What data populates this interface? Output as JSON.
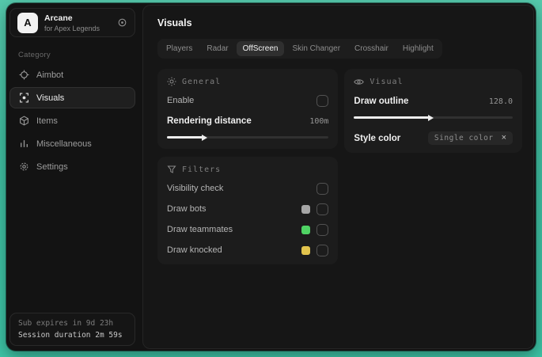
{
  "sidebar": {
    "logo": {
      "letter": "A",
      "title": "Arcane",
      "subtitle": "for Apex Legends"
    },
    "category_label": "Category",
    "items": [
      {
        "label": "Aimbot",
        "icon": "crosshair-icon",
        "active": false
      },
      {
        "label": "Visuals",
        "icon": "eye-scan-icon",
        "active": true
      },
      {
        "label": "Items",
        "icon": "cube-icon",
        "active": false
      },
      {
        "label": "Miscellaneous",
        "icon": "bars-icon",
        "active": false
      },
      {
        "label": "Settings",
        "icon": "gear-icon",
        "active": false
      }
    ],
    "footer": {
      "line1": "Sub expires in 9d 23h",
      "line2": "Session duration 2m 59s"
    }
  },
  "main": {
    "title": "Visuals",
    "tabs": [
      {
        "label": "Players",
        "active": false
      },
      {
        "label": "Radar",
        "active": false
      },
      {
        "label": "OffScreen",
        "active": true
      },
      {
        "label": "Skin Changer",
        "active": false
      },
      {
        "label": "Crosshair",
        "active": false
      },
      {
        "label": "Highlight",
        "active": false
      }
    ],
    "general": {
      "title": "General",
      "enable_label": "Enable",
      "enable_checked": false,
      "rendering_label": "Rendering distance",
      "rendering_value": "100m",
      "slider_percent": 22
    },
    "visual": {
      "title": "Visual",
      "outline_label": "Draw outline",
      "outline_value": "128.0",
      "slider_percent": 47,
      "style_label": "Style color",
      "style_value": "Single color",
      "style_remove_glyph": "×"
    },
    "filters": {
      "title": "Filters",
      "rows": [
        {
          "label": "Visibility check",
          "swatch": null,
          "checked": false
        },
        {
          "label": "Draw bots",
          "swatch": "#a6a6a6",
          "checked": false
        },
        {
          "label": "Draw teammates",
          "swatch": "#4fd364",
          "checked": false
        },
        {
          "label": "Draw knocked",
          "swatch": "#e2c44d",
          "checked": false
        }
      ]
    }
  },
  "colors": {
    "background_accent": "#3fbda0",
    "window_bg": "#131313",
    "card_bg": "#1c1c1c",
    "slider_fill": "#ededed"
  }
}
